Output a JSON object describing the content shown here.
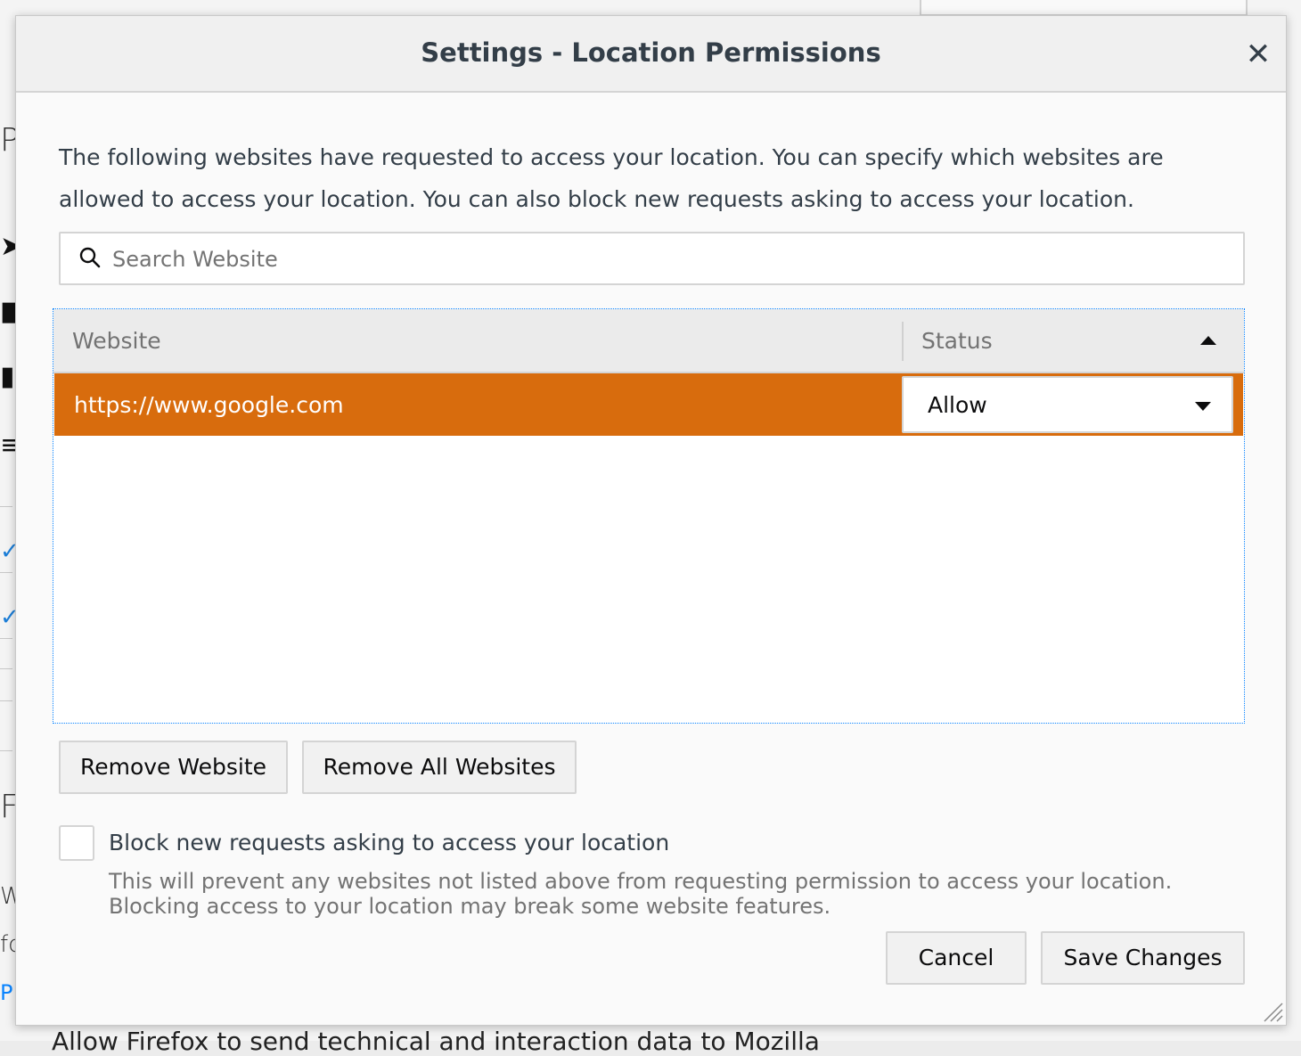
{
  "dialog": {
    "title": "Settings - Location Permissions",
    "close_symbol": "✕",
    "description": "The following websites have requested to access your location. You can specify which websites are allowed to access your location. You can also block new requests asking to access your location."
  },
  "search": {
    "placeholder": "Search Website",
    "value": "",
    "icon": "search-icon"
  },
  "table": {
    "columns": [
      "Website",
      "Status"
    ],
    "sort": {
      "column": "Status",
      "direction": "ascending"
    },
    "rows": [
      {
        "website": "https://www.google.com",
        "status": "Allow",
        "selected": true
      }
    ]
  },
  "buttons": {
    "remove_website": "Remove Website",
    "remove_all_websites": "Remove All Websites",
    "cancel": "Cancel",
    "save_changes": "Save Changes"
  },
  "block_new_requests": {
    "checked": false,
    "label": "Block new requests asking to access your location",
    "help_line1": "This will prevent any websites not listed above from requesting permission to access your location.",
    "help_line2": "Blocking access to your location may break some website features."
  },
  "colors": {
    "selected_row": "#d86c0d",
    "focus_outline": "#0a84ff",
    "title_text": "#333e48"
  }
}
